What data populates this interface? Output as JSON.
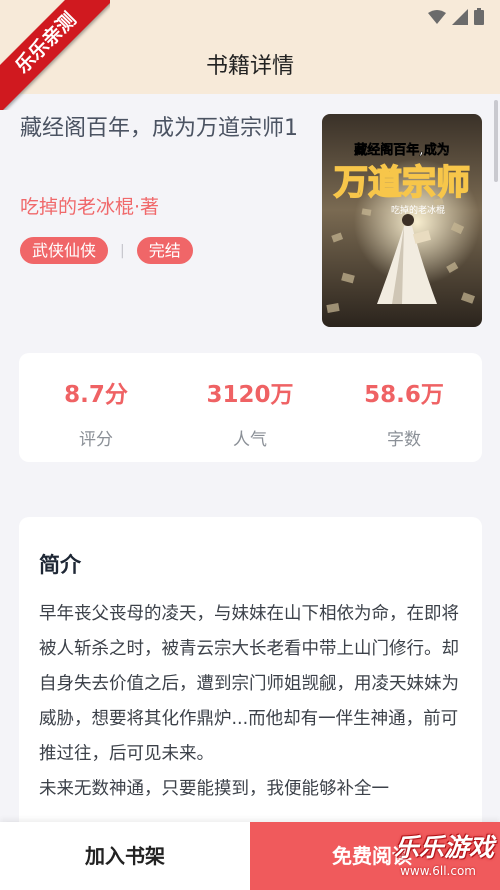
{
  "watermark": {
    "ribbon": "乐乐亲测",
    "brand": "乐乐游戏",
    "url": "www.6ll.com"
  },
  "header": {
    "title": "书籍详情"
  },
  "book": {
    "title": "藏经阁百年，成为万道宗师1",
    "author": "吃掉的老冰棍·著",
    "tags": [
      "武侠仙侠",
      "完结"
    ],
    "tag_separator": "|",
    "cover": {
      "title_line1": "藏经阁百年,成为",
      "title_big": "万道宗师",
      "author": "吃掉的老冰棍"
    }
  },
  "stats": [
    {
      "value": "8.7分",
      "label": "评分"
    },
    {
      "value": "3120万",
      "label": "人气"
    },
    {
      "value": "58.6万",
      "label": "字数"
    }
  ],
  "intro": {
    "heading": "简介",
    "text": "早年丧父丧母的凌天，与妹妹在山下相依为命，在即将被人斩杀之时，被青云宗大长老看中带上山门修行。却自身失去价值之后，遭到宗门师姐觊觎，用凌天妹妹为威胁，想要将其化作鼎炉...而他却有一伴生神通，前可推过往，后可见未来。\n未来无数神通，只要能摸到，我便能够补全一"
  },
  "bottom": {
    "add_shelf": "加入书架",
    "read": "免费阅读"
  },
  "colors": {
    "accent": "#f06668",
    "header_bg": "#f7ead9",
    "page_bg": "#f4f4f8"
  }
}
